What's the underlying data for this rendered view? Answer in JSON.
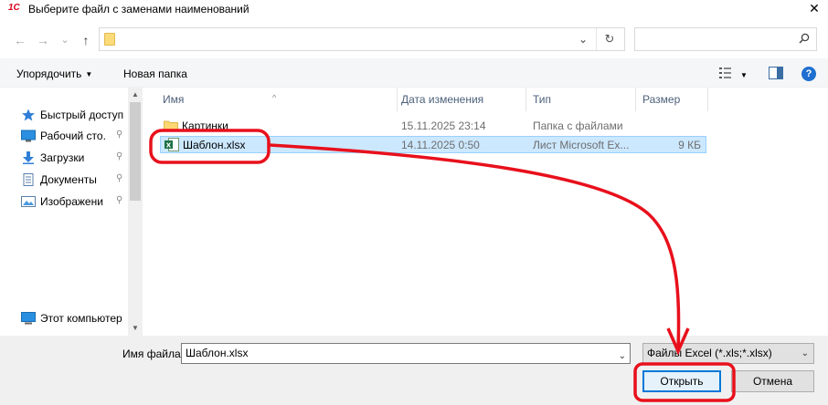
{
  "window": {
    "title": "Выберите файл с заменами наименований",
    "app_logo_text": "1С",
    "close_glyph": "✕"
  },
  "navigation": {
    "back_glyph": "←",
    "forward_glyph": "→",
    "recent_glyph": "⌄",
    "up_glyph": "↑",
    "address_value": "",
    "search_placeholder": ""
  },
  "toolbar": {
    "organize_label": "Упорядочить",
    "organize_arrow": "▼",
    "new_folder_label": "Новая папка",
    "view_arrow": "▼",
    "help_label": "?"
  },
  "sidebar": {
    "items": [
      {
        "label": "Быстрый доступ",
        "icon": "star-icon",
        "pinned": false
      },
      {
        "label": "Рабочий сто.",
        "icon": "desktop-icon",
        "pinned": true
      },
      {
        "label": "Загрузки",
        "icon": "download-icon",
        "pinned": true
      },
      {
        "label": "Документы",
        "icon": "documents-icon",
        "pinned": true
      },
      {
        "label": "Изображени",
        "icon": "pictures-icon",
        "pinned": true
      },
      {
        "label": "Этот компьютер",
        "icon": "computer-icon",
        "pinned": false
      }
    ],
    "pin_glyph": "📌"
  },
  "filelist": {
    "columns": {
      "name": "Имя",
      "date": "Дата изменения",
      "type": "Тип",
      "size": "Размер"
    },
    "rows": [
      {
        "name": "Картинки",
        "date": "15.11.2025 23:14",
        "type": "Папка с файлами",
        "size": "",
        "icon": "folder-icon",
        "selected": false
      },
      {
        "name": "Шаблон.xlsx",
        "date": "14.11.2025 0:50",
        "type": "Лист Microsoft Ex...",
        "size": "9 КБ",
        "icon": "excel-file-icon",
        "selected": true
      }
    ]
  },
  "bottom": {
    "filename_label": "Имя файла:",
    "filename_value": "Шаблон.xlsx",
    "filter_value": "Файлы Excel (*.xls;*.xlsx)",
    "open_label": "Открыть",
    "cancel_label": "Отмена"
  },
  "colors": {
    "selection_bg": "#cce8ff",
    "selection_border": "#99d1ff",
    "annotation_red": "#e8101c",
    "primary_button_border": "#0078d7"
  }
}
